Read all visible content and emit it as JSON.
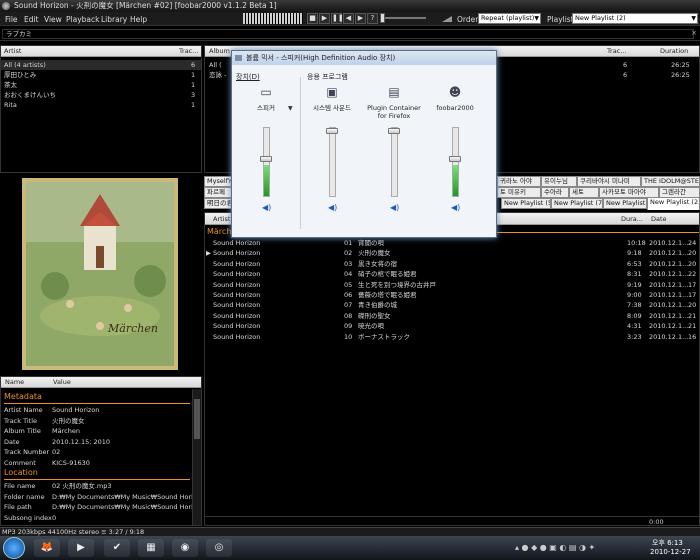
{
  "window": {
    "title": "Sound Horizon - 火刑の魔女 [Märchen #02]   [foobar2000 v1.1.2 Beta 1]"
  },
  "menu": [
    "File",
    "Edit",
    "View",
    "Playback",
    "Library",
    "Help"
  ],
  "toolbar": {
    "order_label": "Order:",
    "order_value": "Repeat (playlist)",
    "playlist_label": "Playlist:",
    "playlist_value": "New Playlist (2)"
  },
  "search": {
    "value": "ラブカミ"
  },
  "artists_panel": {
    "col_artist": "Artist",
    "col_tracks": "Trac...",
    "rows": [
      {
        "name": "All (4 artists)",
        "count": "6"
      },
      {
        "name": "厚田ひとみ",
        "count": "1"
      },
      {
        "name": "茶太",
        "count": "1"
      },
      {
        "name": "おおくまけんいち",
        "count": "3"
      },
      {
        "name": "Rita",
        "count": "1"
      }
    ]
  },
  "albums_panel": {
    "col_album": "Album",
    "col_tracks": "Trac...",
    "col_duration": "Duration",
    "rows": [
      {
        "name": "All (",
        "count": "6",
        "duration": "26:25"
      },
      {
        "name": "恋詠 - ",
        "count": "6",
        "duration": "26:25"
      }
    ]
  },
  "mixer": {
    "title": "볼륨 믹서 - 스피커(High Definition Audio 장치)",
    "device_label": "장치(D)",
    "apps_label": "응용 프로그램",
    "channels": [
      {
        "label": "스피커",
        "icon": "speaker-device-icon",
        "level": 0.55,
        "meter": 0.46
      },
      {
        "label": "시스템 사운드",
        "icon": "system-sounds-icon",
        "level": 0.98,
        "meter": 0.0
      },
      {
        "label": "Plugin Container for Firefox",
        "icon": "plugin-container-icon",
        "level": 0.98,
        "meter": 0.0
      },
      {
        "label": "foobar2000",
        "icon": "foobar-alien-icon",
        "level": 0.55,
        "meter": 0.46
      }
    ]
  },
  "playlist_tabs": {
    "row1": [
      "MyselfY",
      "귀라노 아야",
      "유이누님",
      "쿠리바야시 미나미",
      "THE IDOLM@STER"
    ],
    "row2": [
      "파르페",
      "토 미유키",
      "수아라",
      "세토",
      "사카모토 마아야",
      "그렌라간"
    ],
    "row3": [
      "明日の君",
      "New Playlist (5)",
      "New Playlist (7)",
      "New Playlist",
      "New Playlist (2)"
    ]
  },
  "playlist": {
    "col_artist": "Artist",
    "col_duration": "Dura...",
    "col_date": "Date",
    "group_title": "Märchen",
    "tracks": [
      {
        "artist": "Sound Horizon",
        "no": "01",
        "title": "宵闇の唄",
        "duration": "10:18",
        "date": "2010.12.1...",
        "count": "24"
      },
      {
        "artist": "Sound Horizon",
        "no": "02",
        "title": "火刑の魔女",
        "duration": "9:18",
        "date": "2010.12.1...",
        "count": "20",
        "playing": true
      },
      {
        "artist": "Sound Horizon",
        "no": "03",
        "title": "黒き女将の宿",
        "duration": "6:53",
        "date": "2010.12.1...",
        "count": "20"
      },
      {
        "artist": "Sound Horizon",
        "no": "04",
        "title": "硝子の棺で眠る姫君",
        "duration": "8:31",
        "date": "2010.12.1...",
        "count": "22"
      },
      {
        "artist": "Sound Horizon",
        "no": "05",
        "title": "生と死を別つ境界の古井戸",
        "duration": "9:19",
        "date": "2010.12.1...",
        "count": "17"
      },
      {
        "artist": "Sound Horizon",
        "no": "06",
        "title": "薔薇の塔で眠る姫君",
        "duration": "9:00",
        "date": "2010.12.1...",
        "count": "17"
      },
      {
        "artist": "Sound Horizon",
        "no": "07",
        "title": "青き伯爵の城",
        "duration": "7:38",
        "date": "2010.12.1...",
        "count": "20"
      },
      {
        "artist": "Sound Horizon",
        "no": "08",
        "title": "磔刑の聖女",
        "duration": "8:09",
        "date": "2010.12.1...",
        "count": "21"
      },
      {
        "artist": "Sound Horizon",
        "no": "09",
        "title": "暁光の唄",
        "duration": "4:31",
        "date": "2010.12.1...",
        "count": "21"
      },
      {
        "artist": "Sound Horizon",
        "no": "10",
        "title": "ボーナストラック",
        "duration": "3:23",
        "date": "2010.12.1...",
        "count": "16"
      }
    ]
  },
  "cover": {
    "caption": "Märchen"
  },
  "properties": {
    "col_name": "Name",
    "col_value": "Value",
    "meta_header": "Metadata",
    "meta": [
      {
        "k": "Artist Name",
        "v": "Sound Horizon"
      },
      {
        "k": "Track Title",
        "v": "火刑の魔女"
      },
      {
        "k": "Album Title",
        "v": "Märchen"
      },
      {
        "k": "Date",
        "v": "2010.12.15; 2010"
      },
      {
        "k": "Track Number",
        "v": "02"
      },
      {
        "k": "Comment",
        "v": "KICS-91630"
      }
    ],
    "loc_header": "Location",
    "loc": [
      {
        "k": "File name",
        "v": "02 火刑の魔女.mp3"
      },
      {
        "k": "Folder name",
        "v": "D:₩My Documents₩My Music₩Sound Horizon"
      },
      {
        "k": "File path",
        "v": "D:₩My Documents₩My Music₩Sound Horizon"
      },
      {
        "k": "Subsong index",
        "v": "0"
      }
    ]
  },
  "status": {
    "left": "MP3 203kbps 44100Hz stereo   ≡   3:27 / 9:18",
    "right": "0:00"
  },
  "tray": {
    "time": "오후 6:13",
    "date": "2010-12-27"
  },
  "colors": {
    "accent": "#e8902a",
    "meter_green": "#2fb82f",
    "mixer_bg": "#f1f4f8"
  }
}
